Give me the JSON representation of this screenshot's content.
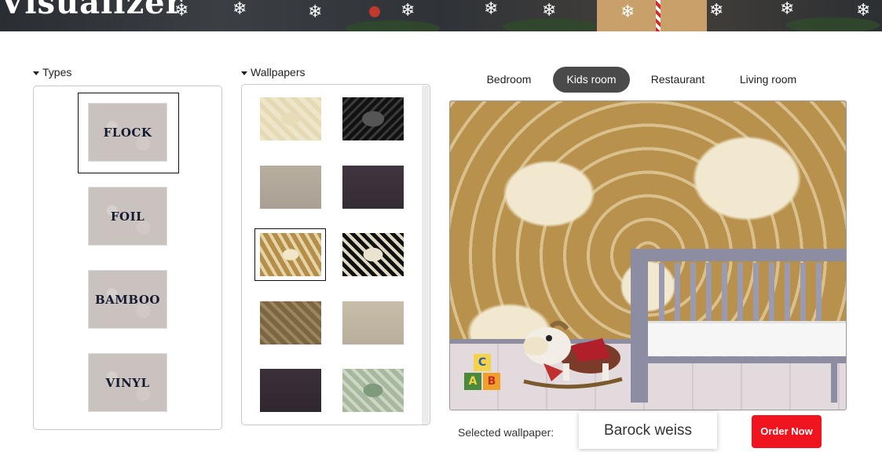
{
  "banner": {
    "title": "Visualizer"
  },
  "types": {
    "header": "Types",
    "items": [
      {
        "label": "FLOCK",
        "selected": true
      },
      {
        "label": "FOIL",
        "selected": false
      },
      {
        "label": "BAMBOO",
        "selected": false
      },
      {
        "label": "VINYL",
        "selected": false
      }
    ]
  },
  "wallpapers": {
    "header": "Wallpapers",
    "swatches": [
      {
        "name": "cream-damask"
      },
      {
        "name": "black-damask"
      },
      {
        "name": "taupe-plain"
      },
      {
        "name": "dark-plum-plain"
      },
      {
        "name": "gold-damask",
        "selected": true
      },
      {
        "name": "black-white-damask"
      },
      {
        "name": "brown-damask"
      },
      {
        "name": "beige-plain"
      },
      {
        "name": "plum-plain"
      },
      {
        "name": "sage-damask"
      }
    ]
  },
  "rooms": {
    "tabs": [
      {
        "label": "Bedroom",
        "active": false
      },
      {
        "label": "Kids room",
        "active": true
      },
      {
        "label": "Restaurant",
        "active": false
      },
      {
        "label": "Living room",
        "active": false
      }
    ]
  },
  "preview": {
    "blocks": [
      "C",
      "A",
      "B"
    ]
  },
  "footer": {
    "selected_label": "Selected wallpaper:",
    "selected_value": "Barock weiss",
    "order_label": "Order Now"
  },
  "colors": {
    "accent": "#f0141e",
    "active_tab": "#4a4a4a"
  }
}
